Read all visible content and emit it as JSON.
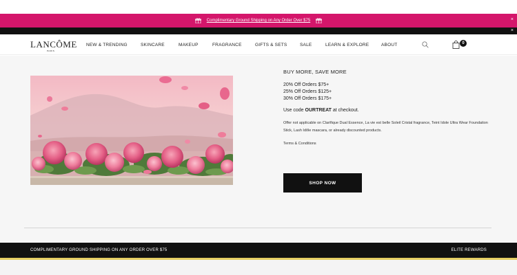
{
  "promo": {
    "text": "Complimentary Ground Shipping on Any Order Over $75",
    "close": "×",
    "color": "#d4166b"
  },
  "blackbar": {
    "close": "×"
  },
  "header": {
    "logo": "LANCÔME",
    "logo_sub": "PARIS",
    "nav": [
      "NEW & TRENDING",
      "SKINCARE",
      "MAKEUP",
      "FRAGRANCE",
      "GIFTS & SETS",
      "SALE",
      "LEARN & EXPLORE",
      "ABOUT"
    ],
    "cart_count": "0"
  },
  "offer": {
    "heading": "BUY MORE, SAVE MORE",
    "tiers": [
      "20% Off Orders $75+",
      "25% Off Orders $125+",
      "30% Off Orders $175+"
    ],
    "code_prefix": "Use code ",
    "code": "OURTREAT",
    "code_suffix": " at checkout.",
    "fine_print": "Offer not applicable on Clarifique Dual Essence, La vie est belle Soleil Cristal fragrance, Teint Idole Ultra Wear Foundation Stick, Lash Idôle mascara, or already discounted products.",
    "terms": "Terms & Conditions",
    "cta": "SHOP NOW"
  },
  "footer": {
    "shipping": "COMPLIMENTARY GROUND SHIPPING ON ANY ORDER OVER $75",
    "rewards": "ELITE REWARDS"
  }
}
